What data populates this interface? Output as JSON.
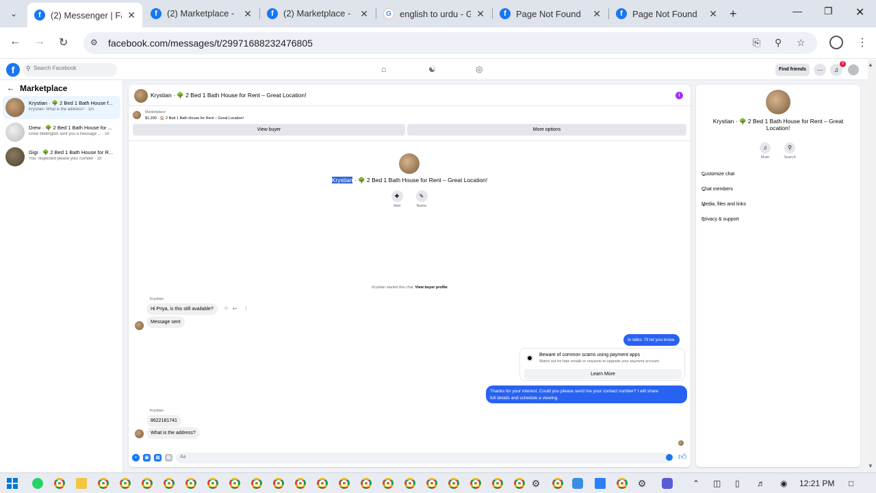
{
  "browser": {
    "tabs": [
      {
        "title": "(2) Messenger | Fac",
        "favicon": "facebook-icon",
        "active": true
      },
      {
        "title": "(2) Marketplace - 🦎",
        "favicon": "facebook-icon",
        "active": false
      },
      {
        "title": "(2) Marketplace - 🦎",
        "favicon": "facebook-icon",
        "active": false
      },
      {
        "title": "english to urdu - G",
        "favicon": "google-icon",
        "active": false
      },
      {
        "title": "Page Not Found",
        "favicon": "facebook-icon",
        "active": false
      },
      {
        "title": "Page Not Found",
        "favicon": "facebook-icon",
        "active": false
      }
    ],
    "url": "facebook.com/messages/t/29971688232476805"
  },
  "fb": {
    "search_placeholder": "Search Facebook",
    "find_friends": "Find friends",
    "notif_count": "2"
  },
  "left": {
    "title": "Marketplace",
    "conversations": [
      {
        "title": "Krystian · 🌳 2 Bed 1 Bath House f...",
        "preview": "Krystian: What is the address? · 1m",
        "active": true
      },
      {
        "title": "Drew · 🌳 2 Bed 1 Bath House for ...",
        "preview": "Drew Wellington sent you a message ... · 1h",
        "active": false
      },
      {
        "title": "Gigi · 🌳 2 Bed 1 Bath House for R...",
        "preview": "You: respected please your number · 1h",
        "active": false
      }
    ]
  },
  "chat": {
    "title": "Krystian · 🌳 2 Bed 1 Bath House for Rent – Great Location!",
    "marketplace_label": "Marketplace",
    "listing": "$1,200 · 🏠 2 Bed 1 Bath House for Rent – Great Location!",
    "view_buyer": "View buyer",
    "more_options": "More options",
    "intro_name_highlight": "Krystian",
    "intro_name_rest": " · 🌳 2 Bed 1 Bath House for Rent – Great Location!",
    "add_label": "Add",
    "name_label": "Name",
    "started_text": "Krystian started this chat.",
    "view_buyer_profile": "View buyer profile",
    "messages": {
      "sender_1": "Krystian",
      "in_1": "Hi Priya, is this still available?",
      "in_2": "Message sent",
      "out_1": "In talks. I'll let you know.",
      "scam_title": "Beware of common scams using payment apps",
      "scam_sub": "Watch out for fake emails or requests to upgrade your payment account.",
      "learn_more": "Learn More",
      "out_2_line1": "Thanks for your interest. Could you please send me your contact number? I will share",
      "out_2_line2": "full details and schedule a viewing.",
      "sender_2": "Krystian",
      "in_3": "8622181741",
      "in_4": "What is the address?"
    },
    "composer_placeholder": "Aa"
  },
  "right": {
    "name": "Krystian · 🌳 2 Bed 1 Bath House for Rent – Great Location!",
    "mute": "Mute",
    "search": "Search",
    "sections": [
      "Customize chat",
      "Chat members",
      "Media, files and links",
      "Privacy & support"
    ]
  },
  "taskbar": {
    "time": "12:21 PM"
  },
  "colors": {
    "accent": "#1877f2",
    "outgoing_bubble": "#2862f2",
    "active_conv": "#ebf5ff"
  }
}
